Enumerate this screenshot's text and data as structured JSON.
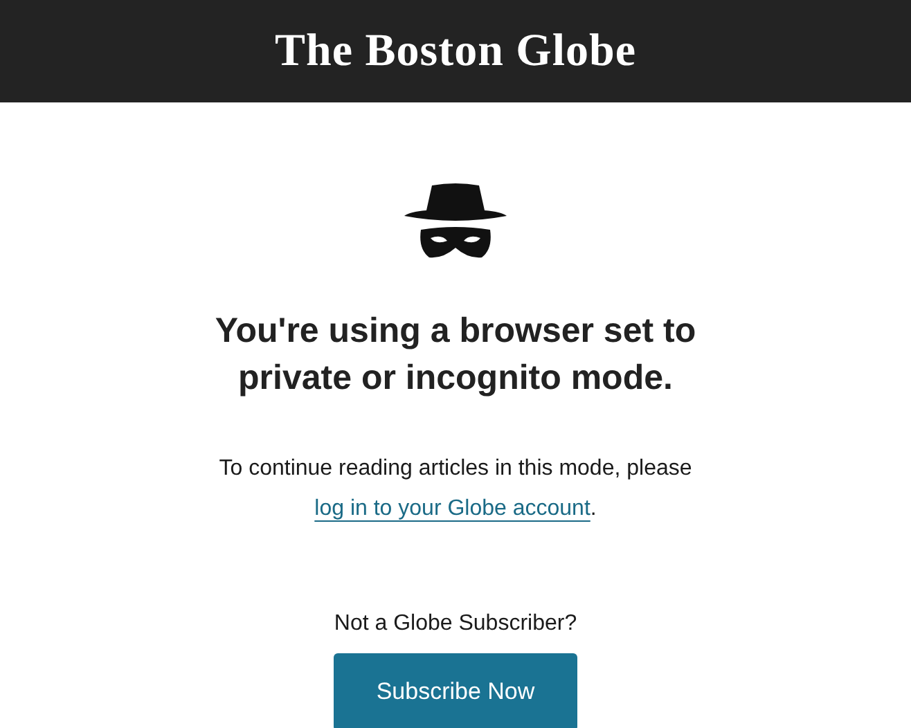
{
  "header": {
    "logo": "The Boston Globe"
  },
  "notice": {
    "heading": "You're using a browser set to private or incognito mode.",
    "message": {
      "before": "To continue reading articles in this mode, please",
      "link": "log in to your Globe account",
      "after": "."
    }
  },
  "subscribe": {
    "prompt": "Not a Globe Subscriber?",
    "button": "Subscribe Now"
  }
}
